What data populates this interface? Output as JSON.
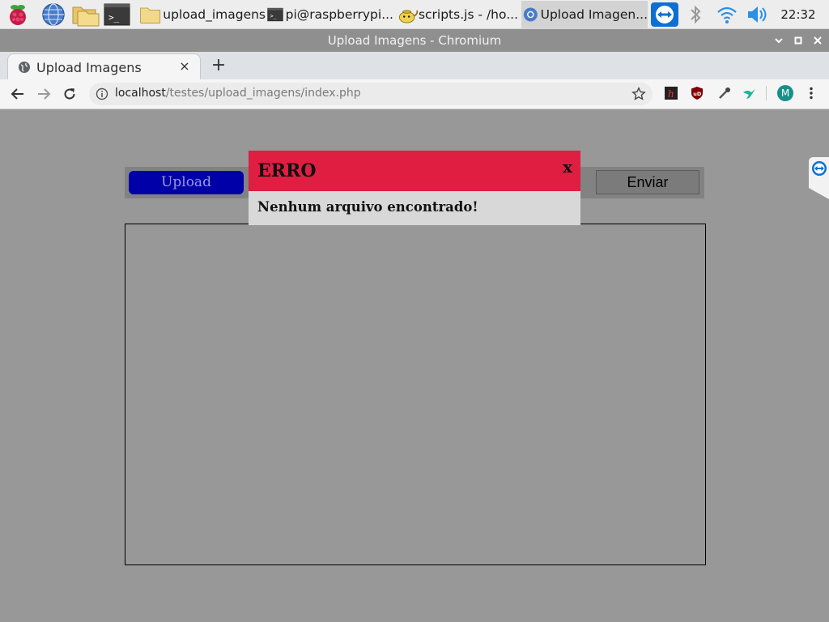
{
  "taskbar": {
    "tasks": [
      {
        "label": "upload_imagens"
      },
      {
        "label": "pi@raspberrypi..."
      },
      {
        "label": "scripts.js - /ho..."
      },
      {
        "label": "Upload Imagen..."
      }
    ],
    "clock": "22:32"
  },
  "window": {
    "title": "Upload Imagens - Chromium"
  },
  "browser": {
    "tab_title": "Upload Imagens",
    "tab_close": "×",
    "new_tab": "+",
    "url_host": "localhost",
    "url_path": "/testes/upload_imagens/index.php",
    "profile_initial": "M"
  },
  "page": {
    "upload_label": "Upload",
    "send_label": "Enviar"
  },
  "modal": {
    "title": "ERRO",
    "close": "x",
    "message": "Nenhum arquivo encontrado!"
  },
  "colors": {
    "modal_header": "#df1e42",
    "upload_button": "#0000a8",
    "page_background": "#989898"
  }
}
